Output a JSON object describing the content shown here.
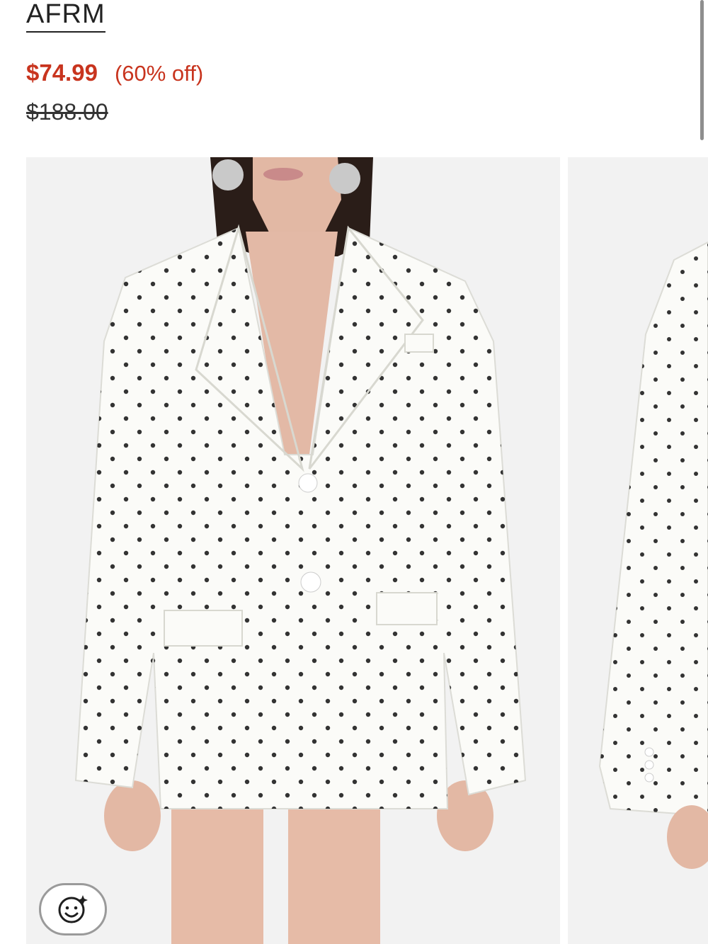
{
  "product": {
    "brand": "AFRM",
    "price_sale": "$74.99",
    "discount": "(60% off)",
    "price_original": "$188.00"
  },
  "colors": {
    "sale": "#c8341e",
    "text": "#222222",
    "photo_bg": "#f2f2f2"
  },
  "gallery": {
    "images": [
      {
        "subject": "white polka dot blazer, front view"
      },
      {
        "subject": "white polka dot blazer, side view"
      }
    ]
  },
  "icons": {
    "try_on": "smiley-sparkle-icon"
  }
}
